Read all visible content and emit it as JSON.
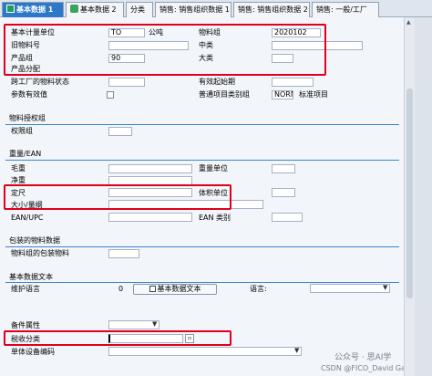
{
  "tabs": [
    {
      "label": "基本数据 1",
      "active": true
    },
    {
      "label": "基本数据 2"
    },
    {
      "label": "分类"
    },
    {
      "label": "销售: 销售组织数据 1"
    },
    {
      "label": "销售: 销售组织数据 2"
    },
    {
      "label": "销售: 一般/工厂"
    }
  ],
  "general": {
    "base_uom_label": "基本计量单位",
    "base_uom_value": "TO",
    "base_uom_text": "公吨",
    "matl_group_label": "物料组",
    "matl_group_value": "2020102",
    "old_matl_label": "旧物料号",
    "ext_matl_group_label": "中类",
    "division_label": "产品组",
    "division_value": "90",
    "class_label": "大类",
    "alloc_label": "产品分配",
    "xplant_status_label": "跨工厂的物料状态",
    "valid_from_label": "有效起始期",
    "param_eff_label": "参数有效值",
    "gen_item_cat_label": "普通项目类别组",
    "gen_item_cat_value": "NORM",
    "gen_item_cat_text": "标准项目"
  },
  "auth": {
    "section": "物料授权组",
    "auth_group_label": "权限组"
  },
  "dims": {
    "section": "重量/EAN",
    "gross_label": "毛重",
    "weight_unit_label": "重量单位",
    "net_label": "净重",
    "volume_label": "定尺",
    "volume_unit_label": "体积单位",
    "size_label": "大小/量纲",
    "ean_label": "EAN/UPC",
    "ean_cat_label": "EAN 类别"
  },
  "pkg": {
    "section": "包装的物料数据",
    "matl_grp_pack_label": "物料组的包装物料"
  },
  "text": {
    "section": "基本数据文本",
    "lang_label": "维护语言",
    "lang_value": "0",
    "button_label": "基本数据文本",
    "lang2_label": "语言:"
  },
  "extra": {
    "spare_label": "备件属性",
    "tax_label": "税收分类",
    "item_code_label": "单体设备编码"
  },
  "watermark": {
    "line1": "公众号 · 思AI学",
    "line2": "CSDN @FICO_David Gao"
  }
}
